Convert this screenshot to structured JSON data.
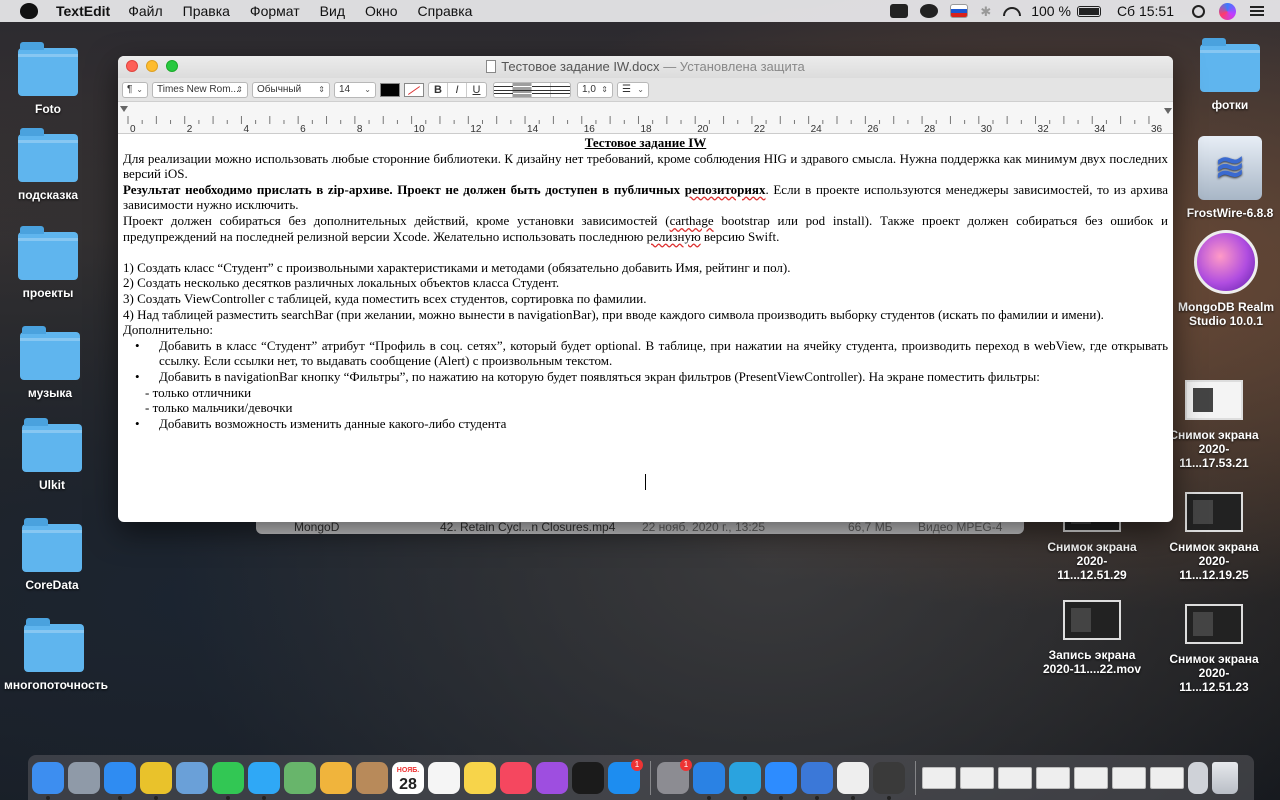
{
  "menubar": {
    "app_name": "TextEdit",
    "items": [
      "Файл",
      "Правка",
      "Формат",
      "Вид",
      "Окно",
      "Справка"
    ],
    "battery": "100 %",
    "clock": "Сб 15:51"
  },
  "desktop_left": [
    {
      "label": "Foto"
    },
    {
      "label": "подсказка"
    },
    {
      "label": "проекты"
    },
    {
      "label": "музыка"
    },
    {
      "label": "Ulkit"
    },
    {
      "label": "CoreData"
    },
    {
      "label": "многопоточность"
    }
  ],
  "desktop_right": {
    "fotki": "фотки",
    "frostwire": "FrostWire-6.8.8",
    "mongo_line1": "MongoDB Realm",
    "mongo_line2": "Studio 10.0.1",
    "shot1_line1": "Снимок экрана",
    "shot1_line2": "2020-11...17.53.21",
    "shot2_line1": "Снимок экрана",
    "shot2_line2": "2020-11...12.51.29",
    "shot3_line1": "Снимок экрана",
    "shot3_line2": "2020-11...12.19.25",
    "rec_line1": "Запись экрана",
    "rec_line2": "2020-11....22.mov",
    "shot4_line1": "Снимок экрана",
    "shot4_line2": "2020-11...12.51.23"
  },
  "finder_row": {
    "name": "42. Retain Cycl...n Closures.mp4",
    "date": "22 нояб. 2020 г., 13:25",
    "size": "66,7 МБ",
    "kind": "Видео MPEG-4",
    "sidebar_item": "MongoD"
  },
  "window": {
    "title": "Тестовое задание IW.docx",
    "subtitle": "— Установлена защита",
    "toolbar": {
      "paragraph": "¶",
      "font": "Times New Rom...",
      "style": "Обычный",
      "size": "14",
      "bold": "B",
      "italic": "I",
      "underline": "U",
      "spacing": "1,0"
    },
    "ruler_labels": [
      "0",
      "2",
      "4",
      "6",
      "8",
      "10",
      "12",
      "14",
      "16",
      "18",
      "20",
      "22",
      "24",
      "26",
      "28",
      "30",
      "32",
      "34",
      "36"
    ],
    "doc": {
      "heading": "Тестовое задание IW",
      "p1": "Для реализации можно использовать любые сторонние библиотеки. К дизайну нет требований, кроме соблюдения HIG и здравого смысла. Нужна поддержка как минимум двух последних версий iOS.",
      "p2_bold_a": "Результат необходимо прислать в zip-архиве. Проект не должен быть доступен в публичных ",
      "p2_bold_b": "репозиториях",
      "p2_rest": ". Если в проекте используются менеджеры зависимостей, то из архива зависимости нужно исключить.",
      "p3_a": "Проект должен собираться без дополнительных действий, кроме установки зависимостей (",
      "p3_b": "carthage",
      "p3_c": " bootstrap или pod install). Также проект должен собираться без ошибок и предупреждений на последней релизной версии Xcode. Желательно использовать последнюю ",
      "p3_d": "релизную",
      "p3_e": " версию Swift.",
      "l1": "1) Создать класс “Студент” с произвольными характеристиками и методами (обязательно добавить Имя, рейтинг и пол).",
      "l2": "2) Создать несколько десятков различных локальных объектов класса Студент.",
      "l3": "3) Создать ViewController с таблицей, куда поместить всех студентов, сортировка по фамилии.",
      "l4": "4) Над таблицей разместить searchBar (при желании, можно вынести в navigationBar), при вводе каждого символа производить выборку студентов (искать по фамилии и имени).",
      "extra": "Дополнительно:",
      "b1": "Добавить в класс “Студент” атрибут “Профиль в соц. сетях”, который будет optional. В таблице, при нажатии на ячейку студента, производить переход в webView, где открывать ссылку. Если ссылки нет, то выдавать сообщение (Alert) с произвольным текстом.",
      "b2": "Добавить в navigationBar кнопку “Фильтры”, по нажатию на которую будет появляться экран фильтров (PresentViewController). На экране поместить фильтры:",
      "d1": "- только отличники",
      "d2": "- только мальчики/девочки",
      "b3": "Добавить возможность изменить данные какого-либо студента"
    }
  },
  "dock": {
    "calendar_month": "НОЯБ.",
    "calendar_day": "28",
    "appstore_badge": "1",
    "prefs_badge": "1",
    "apps": [
      {
        "name": "finder-icon",
        "color": "#3d8ef0"
      },
      {
        "name": "launchpad-icon",
        "color": "#8f9aa8"
      },
      {
        "name": "safari-icon",
        "color": "#2f8cf2"
      },
      {
        "name": "chrome-icon",
        "color": "#e9c22b"
      },
      {
        "name": "preview-icon",
        "color": "#6aa0d8"
      },
      {
        "name": "facetime-icon",
        "color": "#32c754"
      },
      {
        "name": "messages-icon",
        "color": "#2fa8f6"
      },
      {
        "name": "maps-icon",
        "color": "#68b56b"
      },
      {
        "name": "photos-icon",
        "color": "#f0b43c"
      },
      {
        "name": "contacts-icon",
        "color": "#b88a5a"
      },
      {
        "name": "calendar-icon",
        "color": "#ffffff"
      },
      {
        "name": "reminders-icon",
        "color": "#f5f5f5"
      },
      {
        "name": "notes-icon",
        "color": "#f7d44a"
      },
      {
        "name": "music-icon",
        "color": "#f5475f"
      },
      {
        "name": "podcasts-icon",
        "color": "#9e4ee0"
      },
      {
        "name": "appletv-icon",
        "color": "#1b1b1b"
      },
      {
        "name": "appstore-icon",
        "color": "#1d8df0"
      },
      {
        "name": "system-preferences-icon",
        "color": "#8c8c92"
      },
      {
        "name": "xcode-icon",
        "color": "#2a82e4"
      },
      {
        "name": "telegram-icon",
        "color": "#2aa3df"
      },
      {
        "name": "zoom-icon",
        "color": "#2d8cff"
      },
      {
        "name": "xcode-alt-icon",
        "color": "#3b78d8"
      },
      {
        "name": "textedit-icon",
        "color": "#eeeeee"
      },
      {
        "name": "quicktime-icon",
        "color": "#3a3a3a"
      }
    ]
  }
}
